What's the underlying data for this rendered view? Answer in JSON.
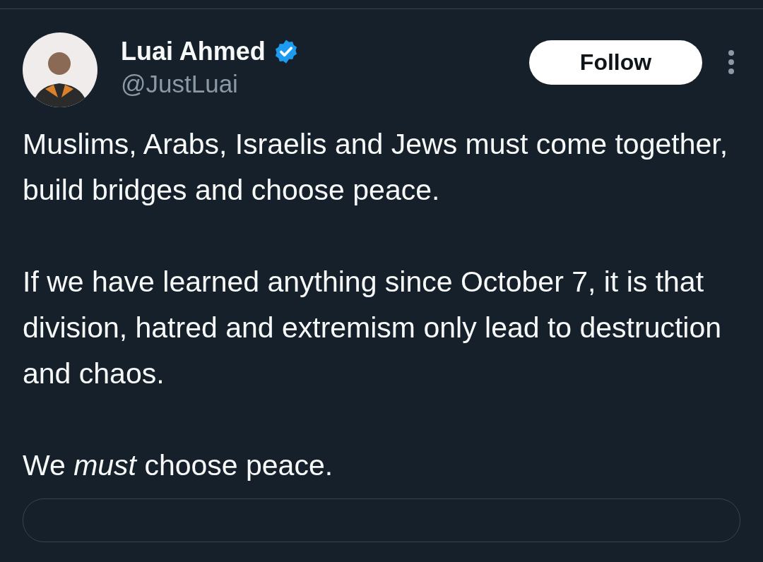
{
  "author": {
    "name": "Luai Ahmed",
    "verified": true,
    "handle": "@JustLuai"
  },
  "follow_button": {
    "label": "Follow"
  },
  "paragraphs": [
    "Muslims, Arabs, Israelis and Jews must come together, build bridges and choose peace.",
    "If we have learned anything since October 7, it is that division, hatred and extremism only lead to destruction and chaos.",
    "We *must* choose peace."
  ]
}
